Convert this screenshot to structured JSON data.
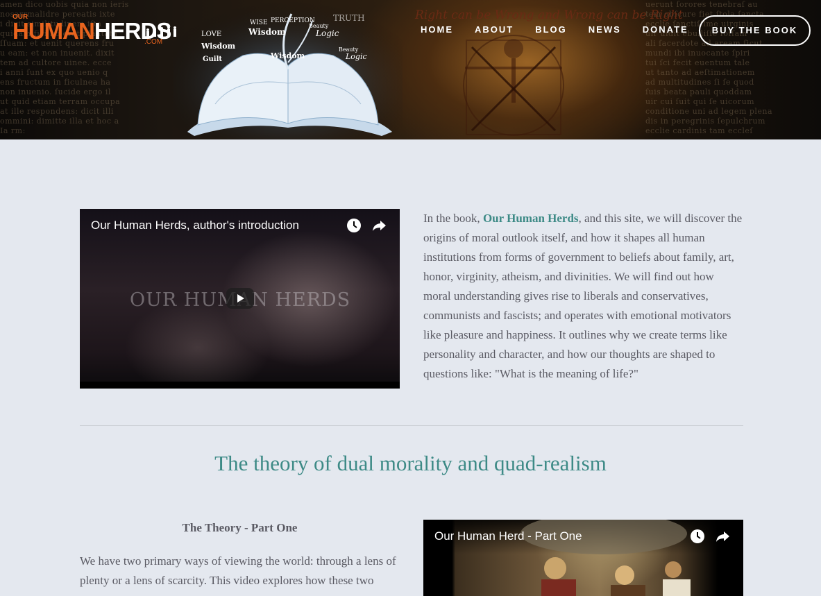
{
  "header": {
    "logo": {
      "our": "OUR",
      "human": "HUMAN",
      "herds": "HERDS",
      "com": ".COM"
    },
    "banner_quote": "Right can be Wrong and Wrong can be Right",
    "nav": [
      "HOME",
      "ABOUT",
      "BLOG",
      "NEWS",
      "DONATE"
    ],
    "buy_button": "BUY THE BOOK"
  },
  "intro": {
    "video_title": "Our Human Herds, author's introduction",
    "video_overlay_text": "OUR HUMAN HERDS",
    "para_before": "In the book, ",
    "para_link": "Our Human Herds",
    "para_after": ", and this site, we will discover the origins of moral outlook itself, and how it shapes all human institutions from forms of government to beliefs about family, art, honor, virginity, atheism, and divinities. We will find out how moral understanding gives rise to liberals and conservatives, communists and fascists; and operates with emotional motivators like pleasure and happiness. It outlines why we create terms like personality and character, and how our thoughts are shaped to questions like: \"What is the meaning of life?\""
  },
  "section": {
    "title": "The theory of dual morality and quad-realism",
    "part_title": "The Theory - Part One",
    "part_text": "We have two primary ways of viewing the world: through a lens of plenty or a lens of scarcity.  This video explores how these two",
    "video_title": "Our Human Herd - Part One"
  },
  "colors": {
    "accent_teal": "#3d8a86",
    "logo_orange": "#e8641e",
    "page_bg": "#e4e8ef",
    "body_text": "#5a5a63"
  }
}
